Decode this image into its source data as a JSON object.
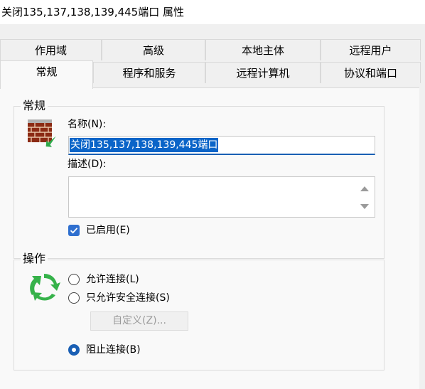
{
  "window": {
    "title": "关闭135,137,138,139,445端口 属性"
  },
  "tabs": {
    "row1": [
      "作用域",
      "高级",
      "本地主体",
      "远程用户"
    ],
    "row2": [
      "常规",
      "程序和服务",
      "远程计算机",
      "协议和端口"
    ],
    "active": "常规"
  },
  "general": {
    "group_title": "常规",
    "name_label": "名称(N):",
    "name_value": "关闭135,137,138,139,445端口",
    "desc_label": "描述(D):",
    "desc_value": "",
    "enabled_label": "已启用(E)",
    "enabled": true
  },
  "action": {
    "group_title": "操作",
    "options": [
      "允许连接(L)",
      "只允许安全连接(S)",
      "阻止连接(B)"
    ],
    "selected": "阻止连接(B)",
    "customize_label": "自定义(Z)..."
  },
  "icons": {
    "firewall": "firewall-icon",
    "action": "green-arrows-cycle-icon"
  }
}
